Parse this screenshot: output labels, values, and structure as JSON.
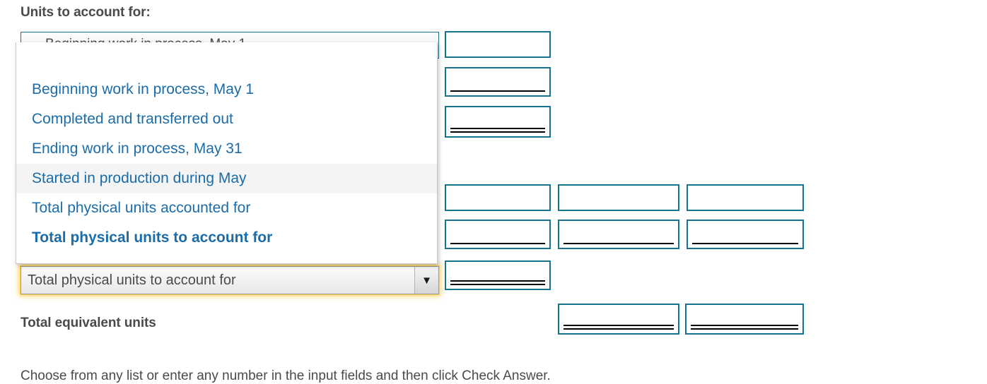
{
  "headings": {
    "units_to_account_for": "Units to account for:",
    "total_equivalent_units": "Total equivalent units"
  },
  "instruction": "Choose from any list or enter any number in the input fields and then click Check Answer.",
  "colors": {
    "input_border": "#17748f",
    "option_text": "#1b6ca8",
    "heading_text": "#4a4a4a",
    "focus_glow": "#ffc428",
    "hover_row": "#f4f4f4"
  },
  "select_behind": {
    "value": "Beginning work in process, May 1"
  },
  "select_focused": {
    "value": "Total physical units to account for",
    "arrow_icon": "chevron-down-icon",
    "arrow_glyph": "▼",
    "state": "focused-open"
  },
  "dropdown": {
    "options": [
      {
        "label": "Beginning work in process, May 1",
        "hovered": false,
        "selected": false
      },
      {
        "label": "Completed and transferred out",
        "hovered": false,
        "selected": false
      },
      {
        "label": "Ending work in process, May 31",
        "hovered": false,
        "selected": false
      },
      {
        "label": "Started in production during May",
        "hovered": true,
        "selected": false
      },
      {
        "label": "Total physical units accounted for",
        "hovered": false,
        "selected": false
      },
      {
        "label": "Total physical units to account for",
        "hovered": false,
        "selected": true
      }
    ]
  },
  "answer_boxes": [
    {
      "id": "box-r1-c1",
      "value": "",
      "underline": "none"
    },
    {
      "id": "box-r2-c1",
      "value": "",
      "underline": "single"
    },
    {
      "id": "box-r3-c1",
      "value": "",
      "underline": "double"
    },
    {
      "id": "box-r4-c1",
      "value": "",
      "underline": "none"
    },
    {
      "id": "box-r4-c2",
      "value": "",
      "underline": "none"
    },
    {
      "id": "box-r4-c3",
      "value": "",
      "underline": "none"
    },
    {
      "id": "box-r5-c1",
      "value": "",
      "underline": "single"
    },
    {
      "id": "box-r5-c2",
      "value": "",
      "underline": "single"
    },
    {
      "id": "box-r5-c3",
      "value": "",
      "underline": "single"
    },
    {
      "id": "box-r6-c1",
      "value": "",
      "underline": "double"
    },
    {
      "id": "box-r7-c2",
      "value": "",
      "underline": "double"
    },
    {
      "id": "box-r7-c3",
      "value": "",
      "underline": "double"
    }
  ]
}
